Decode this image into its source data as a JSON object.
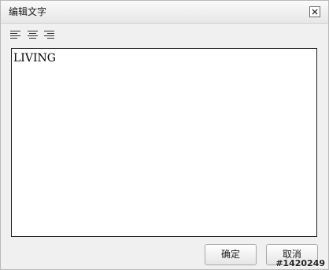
{
  "window": {
    "title": "编辑文字",
    "close_icon": "close-icon"
  },
  "toolbar": {
    "items": [
      {
        "icon": "align-left-icon"
      },
      {
        "icon": "align-center-icon"
      },
      {
        "icon": "align-right-icon"
      }
    ]
  },
  "editor": {
    "value": "LIVING"
  },
  "footer": {
    "ok_label": "确定",
    "cancel_label": "取消"
  },
  "watermark": "#1420249"
}
